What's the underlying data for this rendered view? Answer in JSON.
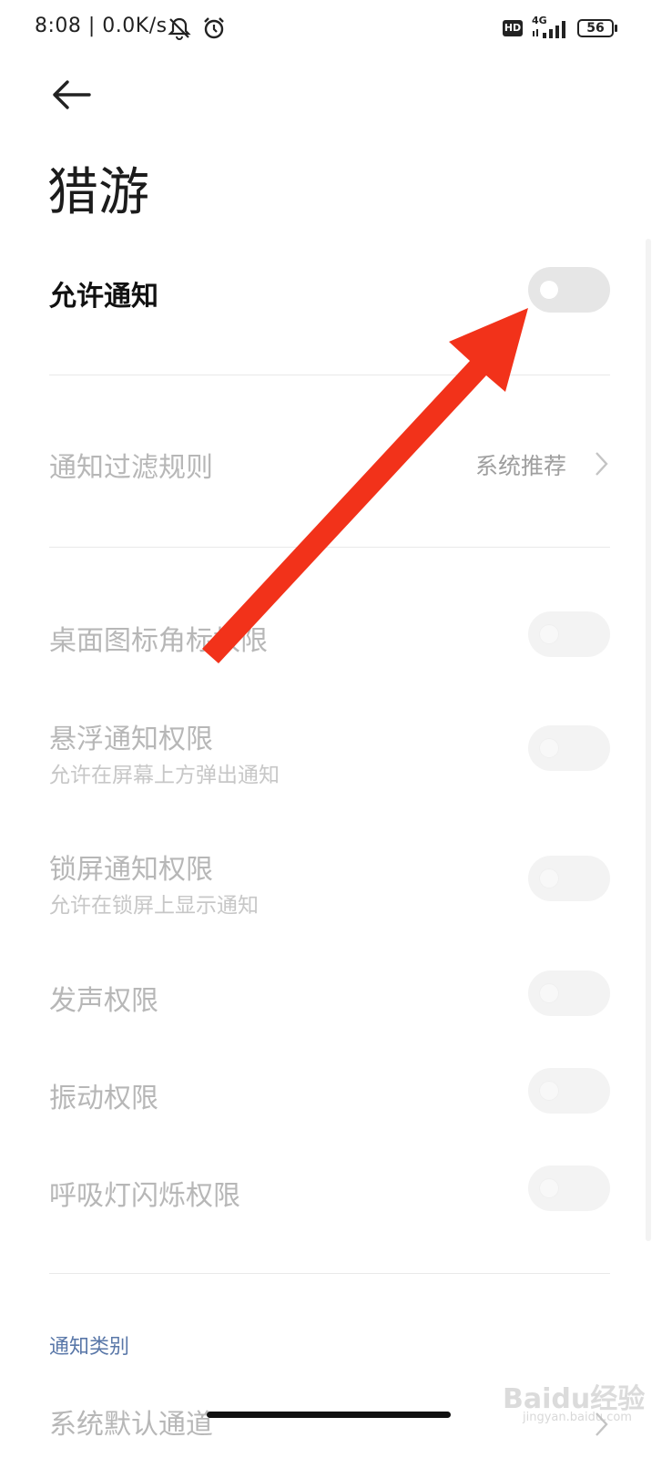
{
  "status_bar": {
    "time_speed": "8:08 | 0.0K/s",
    "network": "4G",
    "hd": "HD",
    "battery": "56"
  },
  "header": {
    "title": "猎游"
  },
  "allow_notifications": {
    "label": "允许通知",
    "enabled": false
  },
  "filter_rule": {
    "label": "通知过滤规则",
    "value": "系统推荐"
  },
  "permissions": [
    {
      "label": "桌面图标角标权限",
      "sub": ""
    },
    {
      "label": "悬浮通知权限",
      "sub": "允许在屏幕上方弹出通知"
    },
    {
      "label": "锁屏通知权限",
      "sub": "允许在锁屏上显示通知"
    },
    {
      "label": "发声权限",
      "sub": ""
    },
    {
      "label": "振动权限",
      "sub": ""
    },
    {
      "label": "呼吸灯闪烁权限",
      "sub": ""
    }
  ],
  "categories": {
    "header": "通知类别",
    "first_item": "系统默认通道"
  },
  "watermark": {
    "text": "Baidu经验",
    "url": "jingyan.baidu.com"
  },
  "colors": {
    "annotation_arrow": "#f2321a",
    "section_header": "#5977a8"
  }
}
